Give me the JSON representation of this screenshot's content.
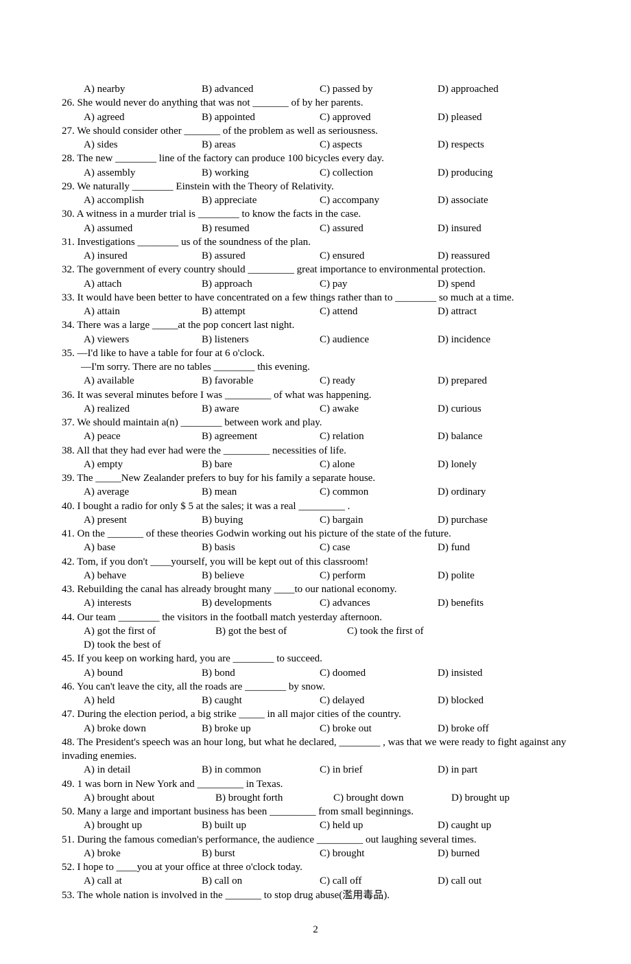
{
  "page_number": "2",
  "questions": [
    {
      "num": "",
      "text": "",
      "opts": [
        "A) nearby",
        "B) advanced",
        "C) passed by",
        "D) approached"
      ]
    },
    {
      "num": "26.",
      "text": "She would   never do anything that was not _______ of by her parents.",
      "opts": [
        "A) agreed",
        "B) appointed",
        "C) approved",
        "D) pleased"
      ]
    },
    {
      "num": "27.",
      "text": "We should consider other _______  of the problem as well as seriousness.",
      "opts": [
        "A) sides",
        "B) areas",
        "C) aspects",
        "D) respects"
      ]
    },
    {
      "num": "28.",
      "text": "The new ________  line of the factory can produce 100 bicycles every day.",
      "opts": [
        "A) assembly",
        "B) working",
        "C) collection",
        "D) producing"
      ]
    },
    {
      "num": "29.",
      "text": " We naturally ________  Einstein with the Theory of Relativity.",
      "opts": [
        "A) accomplish",
        "B) appreciate",
        "C) accompany",
        "D) associate"
      ]
    },
    {
      "num": "30.",
      "text": "A witness in a murder trial is ________  to know the facts in the case.",
      "opts": [
        "A) assumed",
        "B) resumed",
        "C) assured",
        "D) insured"
      ]
    },
    {
      "num": "31.",
      "text": "Investigations ________  us of the soundness of the plan.",
      "opts": [
        "A) insured",
        "B) assured",
        "C) ensured",
        "D) reassured"
      ]
    },
    {
      "num": "32.",
      "text": "The government of every country should _________  great importance to environmental protection.",
      "opts": [
        "A) attach",
        "B) approach",
        "C) pay",
        "D) spend"
      ]
    },
    {
      "num": "33.",
      "text": "It would have been better to have concentrated on a few things rather than to ________  so much at a time.",
      "opts": [
        "A) attain",
        "B) attempt",
        "C) attend",
        "D) attract"
      ]
    },
    {
      "num": "34.",
      "text": " There was a large _____at the pop concert last night.",
      "opts": [
        "A) viewers",
        "B) listeners",
        "C) audience",
        "D) incidence"
      ]
    },
    {
      "num": "35.",
      "text": " —I'd like to have a table for four at 6 o'clock.",
      "text2": "—I'm sorry. There are no tables ________  this evening.",
      "opts": [
        "A) available",
        "B) favorable",
        "C)  ready",
        "D) prepared"
      ]
    },
    {
      "num": "36.",
      "text": " It was several minutes before I was _________  of what was happening.",
      "opts": [
        " A) realized",
        "B) aware",
        "C) awake",
        "D) curious"
      ]
    },
    {
      "num": "37.",
      "text": "We  should maintain a(n) ________  between work and play.",
      "opts": [
        "A) peace",
        "B) agreement",
        "C) relation",
        "D) balance"
      ]
    },
    {
      "num": "38.",
      "text": " All that they had ever had were the _________  necessities of life.",
      "opts": [
        " A)  empty",
        "B) bare",
        "C) alone",
        "D) lonely"
      ]
    },
    {
      "num": "39.",
      "text": " The _____New Zealander prefers to buy for his family a separate house.",
      "opts": [
        " A) average",
        "B) mean",
        "C) common",
        "D) ordinary"
      ]
    },
    {
      "num": "40.",
      "text": "I bought a radio for only $ 5 at the sales; it was a real _________  .",
      "opts": [
        "  A)  present",
        "B) buying",
        "C) bargain",
        "D) purchase"
      ]
    },
    {
      "num": "41.",
      "text": " On the _______  of these theories Godwin working out his picture of the state of the future.",
      "opts": [
        "  A)  base",
        "B) basis",
        "C) case",
        "D) fund"
      ]
    },
    {
      "num": "42.",
      "text": " Tom, if you don't ____yourself, you will be kept out of this classroom!",
      "opts": [
        "  A)  behave",
        "B) believe",
        "C) perform",
        "D) polite"
      ]
    },
    {
      "num": "43.",
      "text": " Rebuilding the canal has already brought many ____to our national economy.",
      "opts": [
        "  A)  interests",
        "B) developments",
        "C) advances",
        "D) benefits"
      ]
    },
    {
      "num": "44.",
      "text": " Our team ________  the visitors in the football match yesterday afternoon.",
      "opts": [
        "A) got the first of",
        "B) got the best of",
        "C) took the first of",
        "D) took the best of"
      ]
    },
    {
      "num": "45.",
      "text": " If you keep on working hard, you are ________  to succeed.",
      "opts": [
        "  A)  bound",
        "B) bond",
        "C) doomed",
        "D) insisted"
      ]
    },
    {
      "num": "46.",
      "text": " You can't leave the city, all the roads are ________  by snow.",
      "opts": [
        "  A)  held",
        "B) caught",
        "C) delayed",
        "D) blocked"
      ]
    },
    {
      "num": "47.",
      "text": " During the election period, a big strike _____  in all major cities of the country.",
      "opts": [
        "  A)  broke down",
        "B) broke up",
        "C) broke out",
        "D) broke off"
      ]
    },
    {
      "num": "48.",
      "text": " The President's speech was an hour long, but what he declared, ________  , was that we were ready to fight against any invading enemies.",
      "opts": [
        "  A)  in detail",
        "B) in common",
        "C) in brief",
        "D) in part"
      ]
    },
    {
      "num": "49.",
      "text": " 1 was born in New York and _________  in Texas.",
      "opts": [
        " A) brought about",
        "B) brought forth",
        "C) brought down",
        "D) brought up"
      ]
    },
    {
      "num": "50.",
      "text": " Many a large and important business has been _________  from small beginnings.",
      "opts": [
        " A) brought up",
        "B) built up",
        "C) held up",
        "D)  caught up"
      ]
    },
    {
      "num": "51.",
      "text": " During the famous comedian's performance, the audience _________  out laughing several times.",
      "opts": [
        "A) broke",
        "B) burst",
        "C) brought",
        "D) burned"
      ]
    },
    {
      "num": "52.",
      "text": " I hope to ____you at your office at three o'clock today.",
      "opts": [
        "  A) call at",
        "B) call on",
        "C) call off",
        "D) call out"
      ]
    },
    {
      "num": "53.",
      "text": "The whole nation is involved in the _______  to stop drug abuse(濫用毒品).",
      "opts": null
    }
  ]
}
